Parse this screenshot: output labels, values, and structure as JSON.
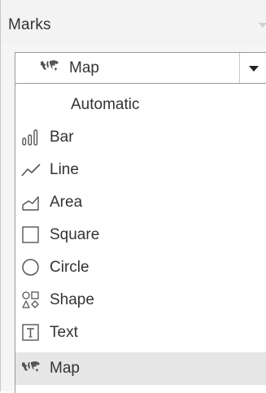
{
  "panel": {
    "title": "Marks"
  },
  "mark_type_dropdown": {
    "selected_label": "Map",
    "icon": "map-icon"
  },
  "menu": {
    "items": [
      {
        "label": "Automatic",
        "icon": null,
        "selected": false
      },
      {
        "label": "Bar",
        "icon": "bar-icon",
        "selected": false
      },
      {
        "label": "Line",
        "icon": "line-icon",
        "selected": false
      },
      {
        "label": "Area",
        "icon": "area-icon",
        "selected": false
      },
      {
        "label": "Square",
        "icon": "square-icon",
        "selected": false
      },
      {
        "label": "Circle",
        "icon": "circle-icon",
        "selected": false
      },
      {
        "label": "Shape",
        "icon": "shape-icon",
        "selected": false
      },
      {
        "label": "Text",
        "icon": "text-icon",
        "selected": false
      },
      {
        "label": "Map",
        "icon": "map-icon",
        "selected": true
      }
    ]
  },
  "colors": {
    "icon": "#555555",
    "selected_bg": "#e6e6e6",
    "text": "#333333"
  }
}
